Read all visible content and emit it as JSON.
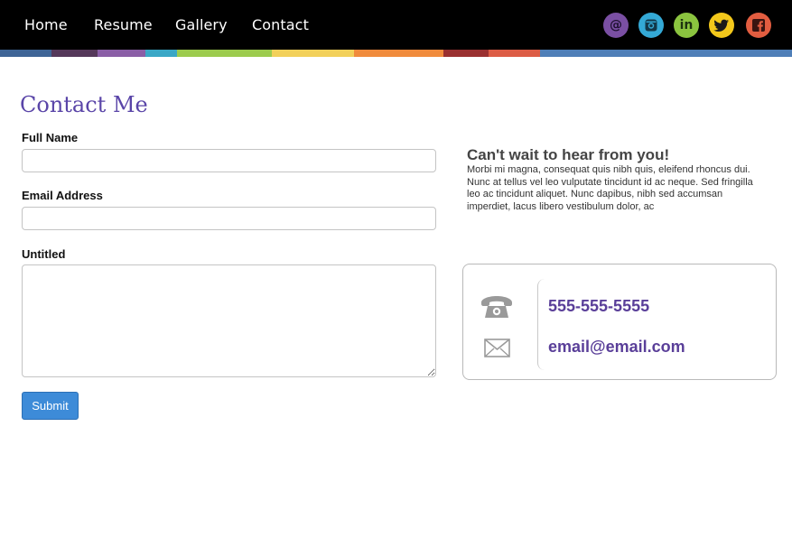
{
  "nav": {
    "links": [
      "Home",
      "Resume",
      "Gallery",
      "Contact"
    ],
    "social": [
      {
        "icon": "email-icon",
        "glyph": "@",
        "color": "#7a4fa3"
      },
      {
        "icon": "instagram-icon",
        "color": "#34a9d6"
      },
      {
        "icon": "linkedin-icon",
        "glyph": "in",
        "color": "#8bc43f"
      },
      {
        "icon": "twitter-icon",
        "color": "#f3c81b"
      },
      {
        "icon": "facebook-icon",
        "color": "#e25d40"
      }
    ],
    "stripe_colors": [
      "#3e6496",
      "#55385a",
      "#8a5ea6",
      "#3aa7c6",
      "#9ccb4d",
      "#f2d05a",
      "#f08b3c",
      "#9a3030",
      "#dc5c45",
      "#4f7fb8"
    ]
  },
  "form": {
    "title": "Contact Me",
    "full_name_label": "Full Name",
    "full_name_value": "",
    "email_label": "Email Address",
    "email_value": "",
    "message_label": "Untitled",
    "message_value": "",
    "submit_label": "Submit"
  },
  "promo": {
    "heading": "Can't wait to hear from you!",
    "body": "Morbi mi magna, consequat quis nibh quis, eleifend rhoncus dui. Nunc at tellus vel leo vulputate tincidunt id ac neque. Sed fringilla leo ac tincidunt aliquet. Nunc dapibus, nibh sed accumsan imperdiet, lacus libero vestibulum dolor, ac"
  },
  "contact_card": {
    "phone": "555-555-5555",
    "email": "email@email.com",
    "phone_icon": "telephone-icon",
    "email_icon": "envelope-icon"
  },
  "colors": {
    "nav_bg": "#000000",
    "title": "#5a45a8",
    "accent_text": "#5a3f99",
    "button": "#3d8bd8"
  }
}
